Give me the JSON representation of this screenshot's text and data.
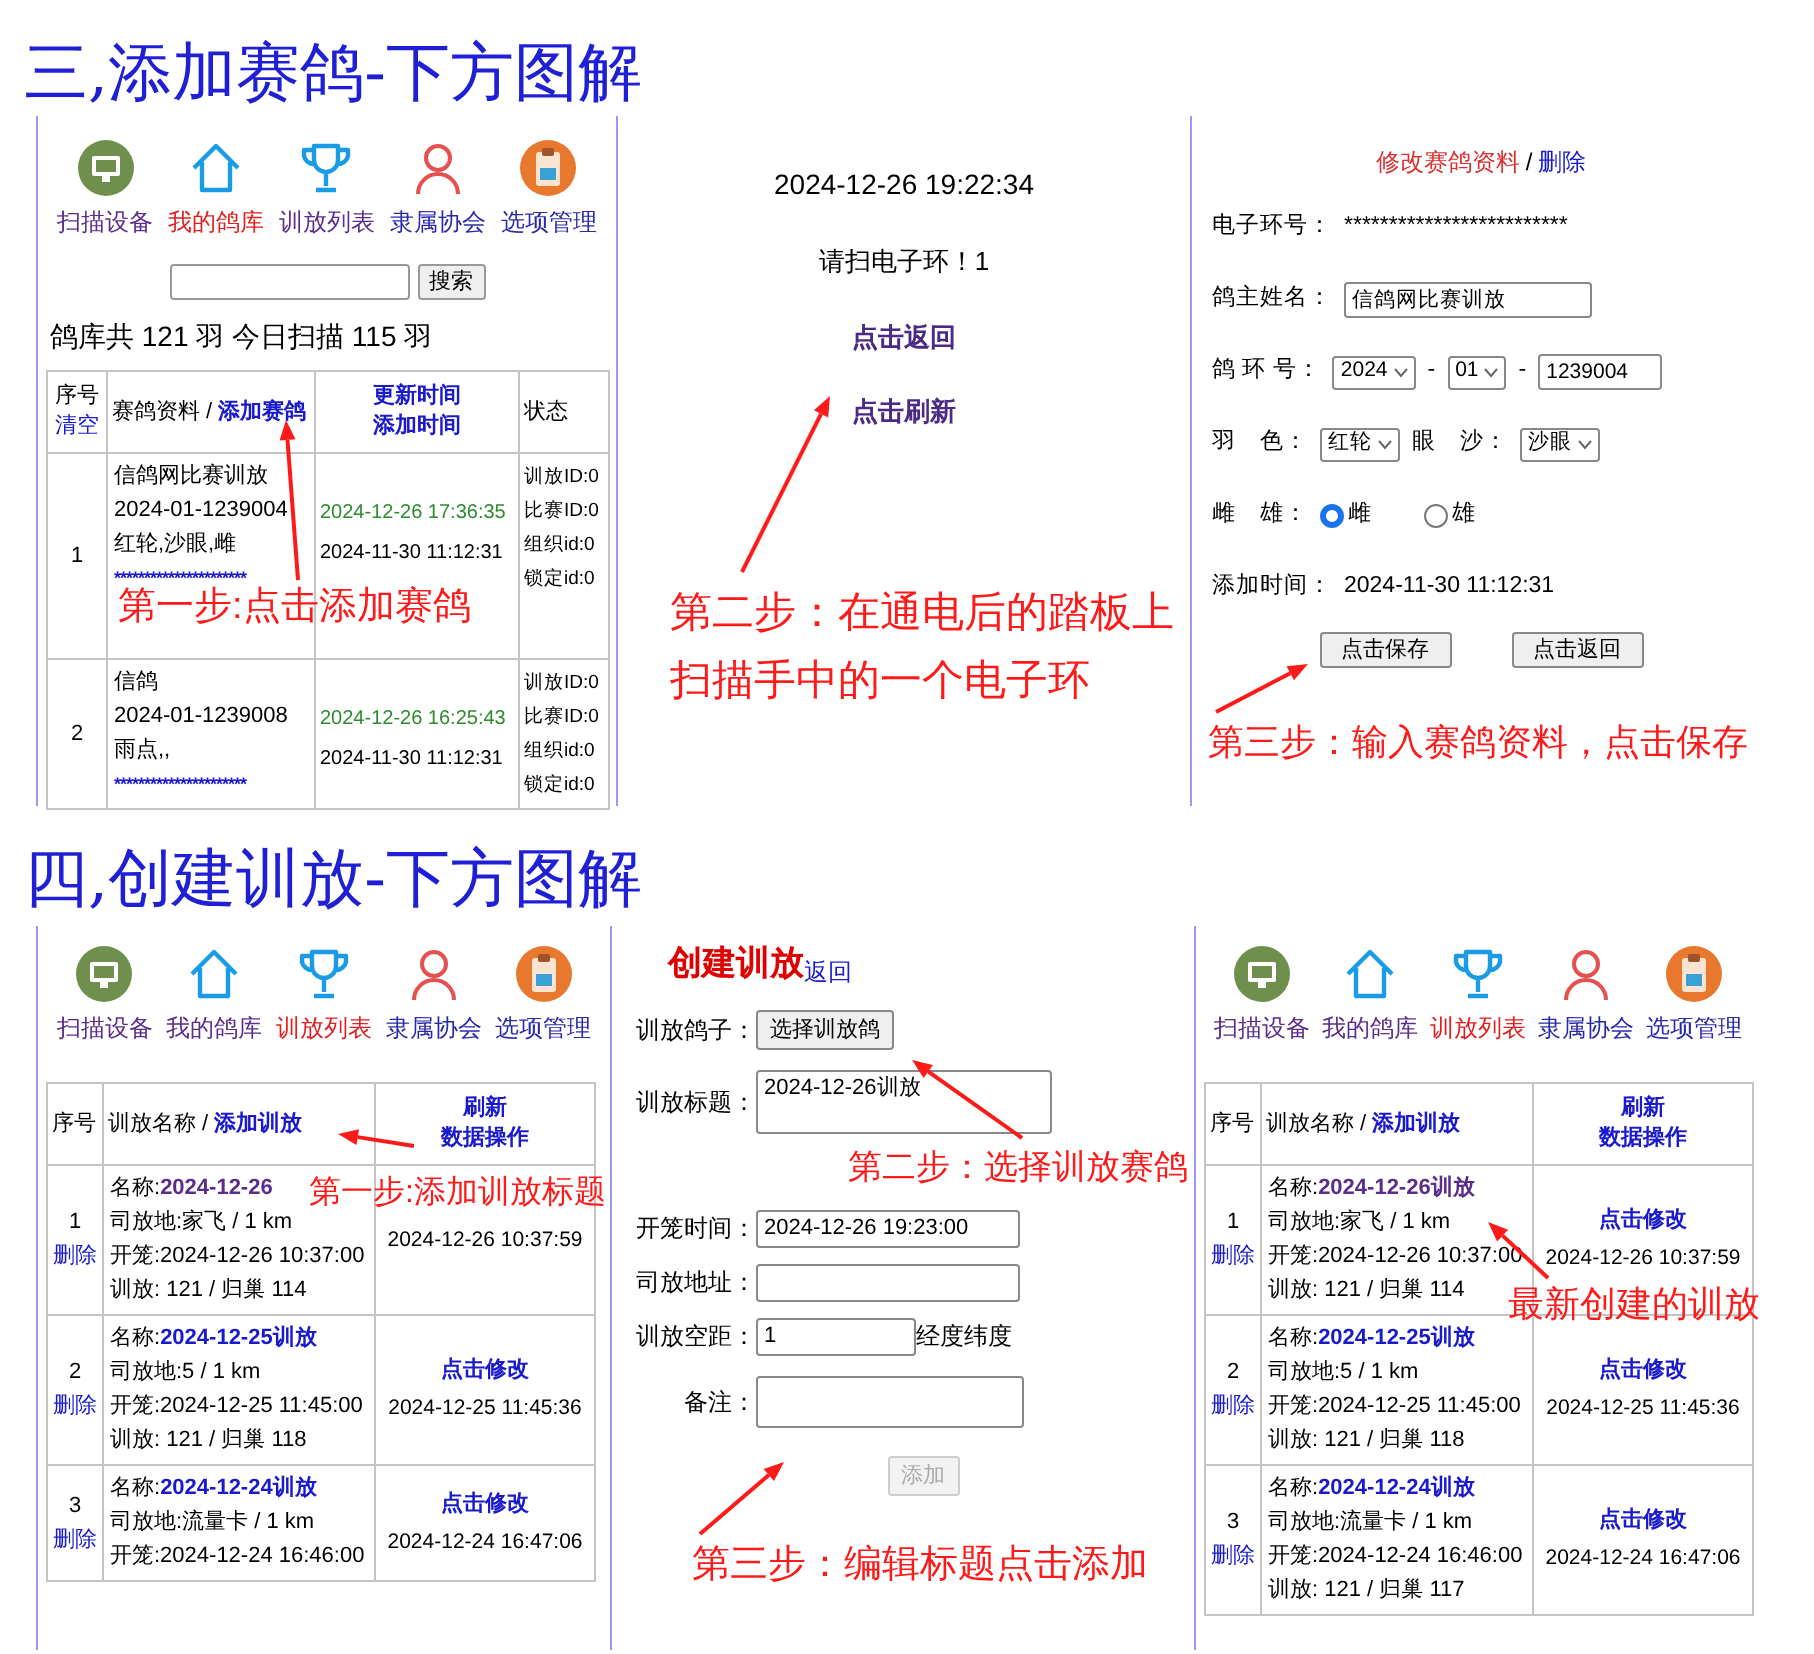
{
  "sections": [
    {
      "title": "三,添加赛鸽-下方图解",
      "panels": [
        {
          "kind": "pigeon_list",
          "nav": [
            {
              "label": "扫描设备",
              "selected": false,
              "visited": true
            },
            {
              "label": "我的鸽库",
              "selected": true
            },
            {
              "label": "训放列表",
              "selected": false,
              "visited": true
            },
            {
              "label": "隶属协会",
              "selected": false,
              "visited": false
            },
            {
              "label": "选项管理",
              "selected": false,
              "visited": false
            }
          ],
          "search": {
            "button": "搜索"
          },
          "summary": "鸽库共 121 羽 今日扫描 115 羽",
          "columns": [
            {
              "kind": "stacked",
              "text": "序号",
              "links": [
                "清空"
              ]
            },
            {
              "kind": "inline",
              "text": "赛鸽资料 / ",
              "links": [
                "添加赛鸽"
              ]
            },
            {
              "kind": "stacked",
              "links": [
                "更新时间",
                "添加时间"
              ]
            },
            {
              "kind": "inline",
              "text": "状态"
            }
          ],
          "rows": [
            {
              "index": "1",
              "name": "信鸽网比赛训放",
              "ring": "2024-01-1239004",
              "traits": "红轮,沙眼,雌",
              "chip": "**********************",
              "updated": "2024-12-26 17:36:35",
              "added": "2024-11-30 11:12:31",
              "status": [
                "训放ID:0",
                "比赛ID:0",
                "组织id:0",
                "锁定id:0"
              ]
            },
            {
              "index": "2",
              "name": "信鸽",
              "ring": "2024-01-1239008",
              "traits": "雨点,,",
              "chip": "**********************",
              "updated": "2024-12-26 16:25:43",
              "added": "2024-11-30 11:12:31",
              "status": [
                "训放ID:0",
                "比赛ID:0",
                "组织id:0",
                "锁定id:0"
              ]
            }
          ],
          "annotations": [
            {
              "lines": [
                "第一步:点击添加赛鸽"
              ]
            }
          ]
        },
        {
          "kind": "scan",
          "time": "2024-12-26 19:22:34",
          "prompt": "请扫电子环！1",
          "links": [
            "点击返回",
            "点击刷新"
          ],
          "annotations": [
            {
              "lines": [
                "第二步：在通电后的踏板上",
                "扫描手中的一个电子环"
              ]
            }
          ]
        },
        {
          "kind": "edit_form",
          "heading": "修改赛鸽资料",
          "separator": "/",
          "delete": "删除",
          "fields": [
            {
              "label": "电子环号：",
              "controls": [
                {
                  "kind": "text",
                  "value": "*************************"
                }
              ]
            },
            {
              "label": "鸽主姓名：",
              "controls": [
                {
                  "kind": "input",
                  "value": "信鸽网比赛训放"
                }
              ]
            },
            {
              "label": "鸽 环 号：",
              "controls": [
                {
                  "kind": "select",
                  "value": "2024"
                },
                {
                  "kind": "text",
                  "value": "-"
                },
                {
                  "kind": "select",
                  "value": "01"
                },
                {
                  "kind": "text",
                  "value": "-"
                },
                {
                  "kind": "input",
                  "value": "1239004"
                }
              ]
            },
            {
              "label": "羽　色：",
              "controls": [
                {
                  "kind": "select",
                  "value": "红轮"
                },
                {
                  "kind": "text",
                  "value": "眼　沙："
                },
                {
                  "kind": "select",
                  "value": "沙眼"
                }
              ]
            },
            {
              "label": "雌　雄：",
              "controls": [
                {
                  "kind": "radio",
                  "value": "雌",
                  "selected": true
                },
                {
                  "kind": "radio",
                  "value": "雄",
                  "selected": false
                }
              ]
            },
            {
              "label": "添加时间：",
              "controls": [
                {
                  "kind": "text",
                  "value": "2024-11-30 11:12:31"
                }
              ]
            }
          ],
          "buttons": [
            "点击保存",
            "点击返回"
          ],
          "annotations": [
            {
              "lines": [
                "第三步：输入赛鸽资料，点击保存"
              ]
            }
          ]
        }
      ]
    },
    {
      "title": "四,创建训放-下方图解",
      "panels": [
        {
          "kind": "training_list",
          "nav": [
            {
              "label": "扫描设备",
              "selected": false,
              "visited": true
            },
            {
              "label": "我的鸽库",
              "selected": false,
              "visited": true
            },
            {
              "label": "训放列表",
              "selected": true
            },
            {
              "label": "隶属协会",
              "selected": false,
              "visited": false
            },
            {
              "label": "选项管理",
              "selected": false,
              "visited": false
            }
          ],
          "columns": [
            {
              "kind": "inline",
              "text": "序号"
            },
            {
              "kind": "inline",
              "text": "训放名称 / ",
              "links": [
                "添加训放"
              ]
            },
            {
              "kind": "stacked",
              "links": [
                "刷新",
                "数据操作"
              ]
            }
          ],
          "rows": [
            {
              "index": "1",
              "delete": "删除",
              "name_label": "名称:",
              "name": "2024-12-26",
              "visited": true,
              "lines": [
                "司放地:家飞 / 1 km",
                "开笼:2024-12-26 10:37:00",
                "训放: 121 / 归巢 114"
              ],
              "time": "2024-12-26 10:37:59"
            },
            {
              "index": "2",
              "delete": "删除",
              "name_label": "名称:",
              "name": "2024-12-25训放",
              "visited": false,
              "lines": [
                "司放地:5 / 1 km",
                "开笼:2024-12-25 11:45:00",
                "训放: 121 / 归巢 118"
              ],
              "action": "点击修改",
              "time": "2024-12-25 11:45:36"
            },
            {
              "index": "3",
              "delete": "删除",
              "name_label": "名称:",
              "name": "2024-12-24训放",
              "visited": false,
              "lines": [
                "司放地:流量卡 / 1 km",
                "开笼:2024-12-24 16:46:00"
              ],
              "action": "点击修改",
              "time": "2024-12-24 16:47:06"
            }
          ],
          "annotations": [
            {
              "lines": [
                "第一步:添加训放标题"
              ]
            }
          ]
        },
        {
          "kind": "create_form",
          "title": "创建训放",
          "back": "返回",
          "fields": [
            {
              "label": "训放鸽子：",
              "kind": "button",
              "value": "选择训放鸽"
            },
            {
              "label": "训放标题：",
              "kind": "textarea",
              "value": "2024-12-26训放"
            },
            {
              "label": "开笼时间：",
              "kind": "input",
              "value": "2024-12-26 19:23:00"
            },
            {
              "label": "司放地址：",
              "kind": "input"
            },
            {
              "label": "训放空距：",
              "kind": "input",
              "value": "1",
              "suffix": "经度纬度"
            },
            {
              "label": "备注：",
              "kind": "textarea"
            }
          ],
          "submit": {
            "label": "添加",
            "disabled": true
          },
          "annotations": [
            {
              "lines": [
                "第二步：选择训放赛鸽"
              ]
            },
            {
              "lines": [
                "第三步：编辑标题点击添加"
              ]
            }
          ]
        },
        {
          "kind": "training_list",
          "nav": [
            {
              "label": "扫描设备",
              "selected": false,
              "visited": true
            },
            {
              "label": "我的鸽库",
              "selected": false,
              "visited": true
            },
            {
              "label": "训放列表",
              "selected": true
            },
            {
              "label": "隶属协会",
              "selected": false,
              "visited": false
            },
            {
              "label": "选项管理",
              "selected": false,
              "visited": false
            }
          ],
          "columns": [
            {
              "kind": "inline",
              "text": "序号"
            },
            {
              "kind": "inline",
              "text": "训放名称 / ",
              "links": [
                "添加训放"
              ]
            },
            {
              "kind": "stacked",
              "links": [
                "刷新",
                "数据操作"
              ]
            }
          ],
          "rows": [
            {
              "index": "1",
              "delete": "删除",
              "name_label": "名称:",
              "name": "2024-12-26训放",
              "visited": true,
              "lines": [
                "司放地:家飞 / 1 km",
                "开笼:2024-12-26 10:37:00",
                "训放: 121 / 归巢 114"
              ],
              "action": "点击修改",
              "time": "2024-12-26 10:37:59"
            },
            {
              "index": "2",
              "delete": "删除",
              "name_label": "名称:",
              "name": "2024-12-25训放",
              "visited": false,
              "lines": [
                "司放地:5 / 1 km",
                "开笼:2024-12-25 11:45:00",
                "训放: 121 / 归巢 118"
              ],
              "action": "点击修改",
              "time": "2024-12-25 11:45:36"
            },
            {
              "index": "3",
              "delete": "删除",
              "name_label": "名称:",
              "name": "2024-12-24训放",
              "visited": false,
              "lines": [
                "司放地:流量卡 / 1 km",
                "开笼:2024-12-24 16:46:00",
                "训放: 121 / 归巢 117"
              ],
              "action": "点击修改",
              "time": "2024-12-24 16:47:06"
            }
          ],
          "annotations": [
            {
              "lines": [
                "最新创建的训放"
              ]
            }
          ]
        }
      ]
    }
  ]
}
